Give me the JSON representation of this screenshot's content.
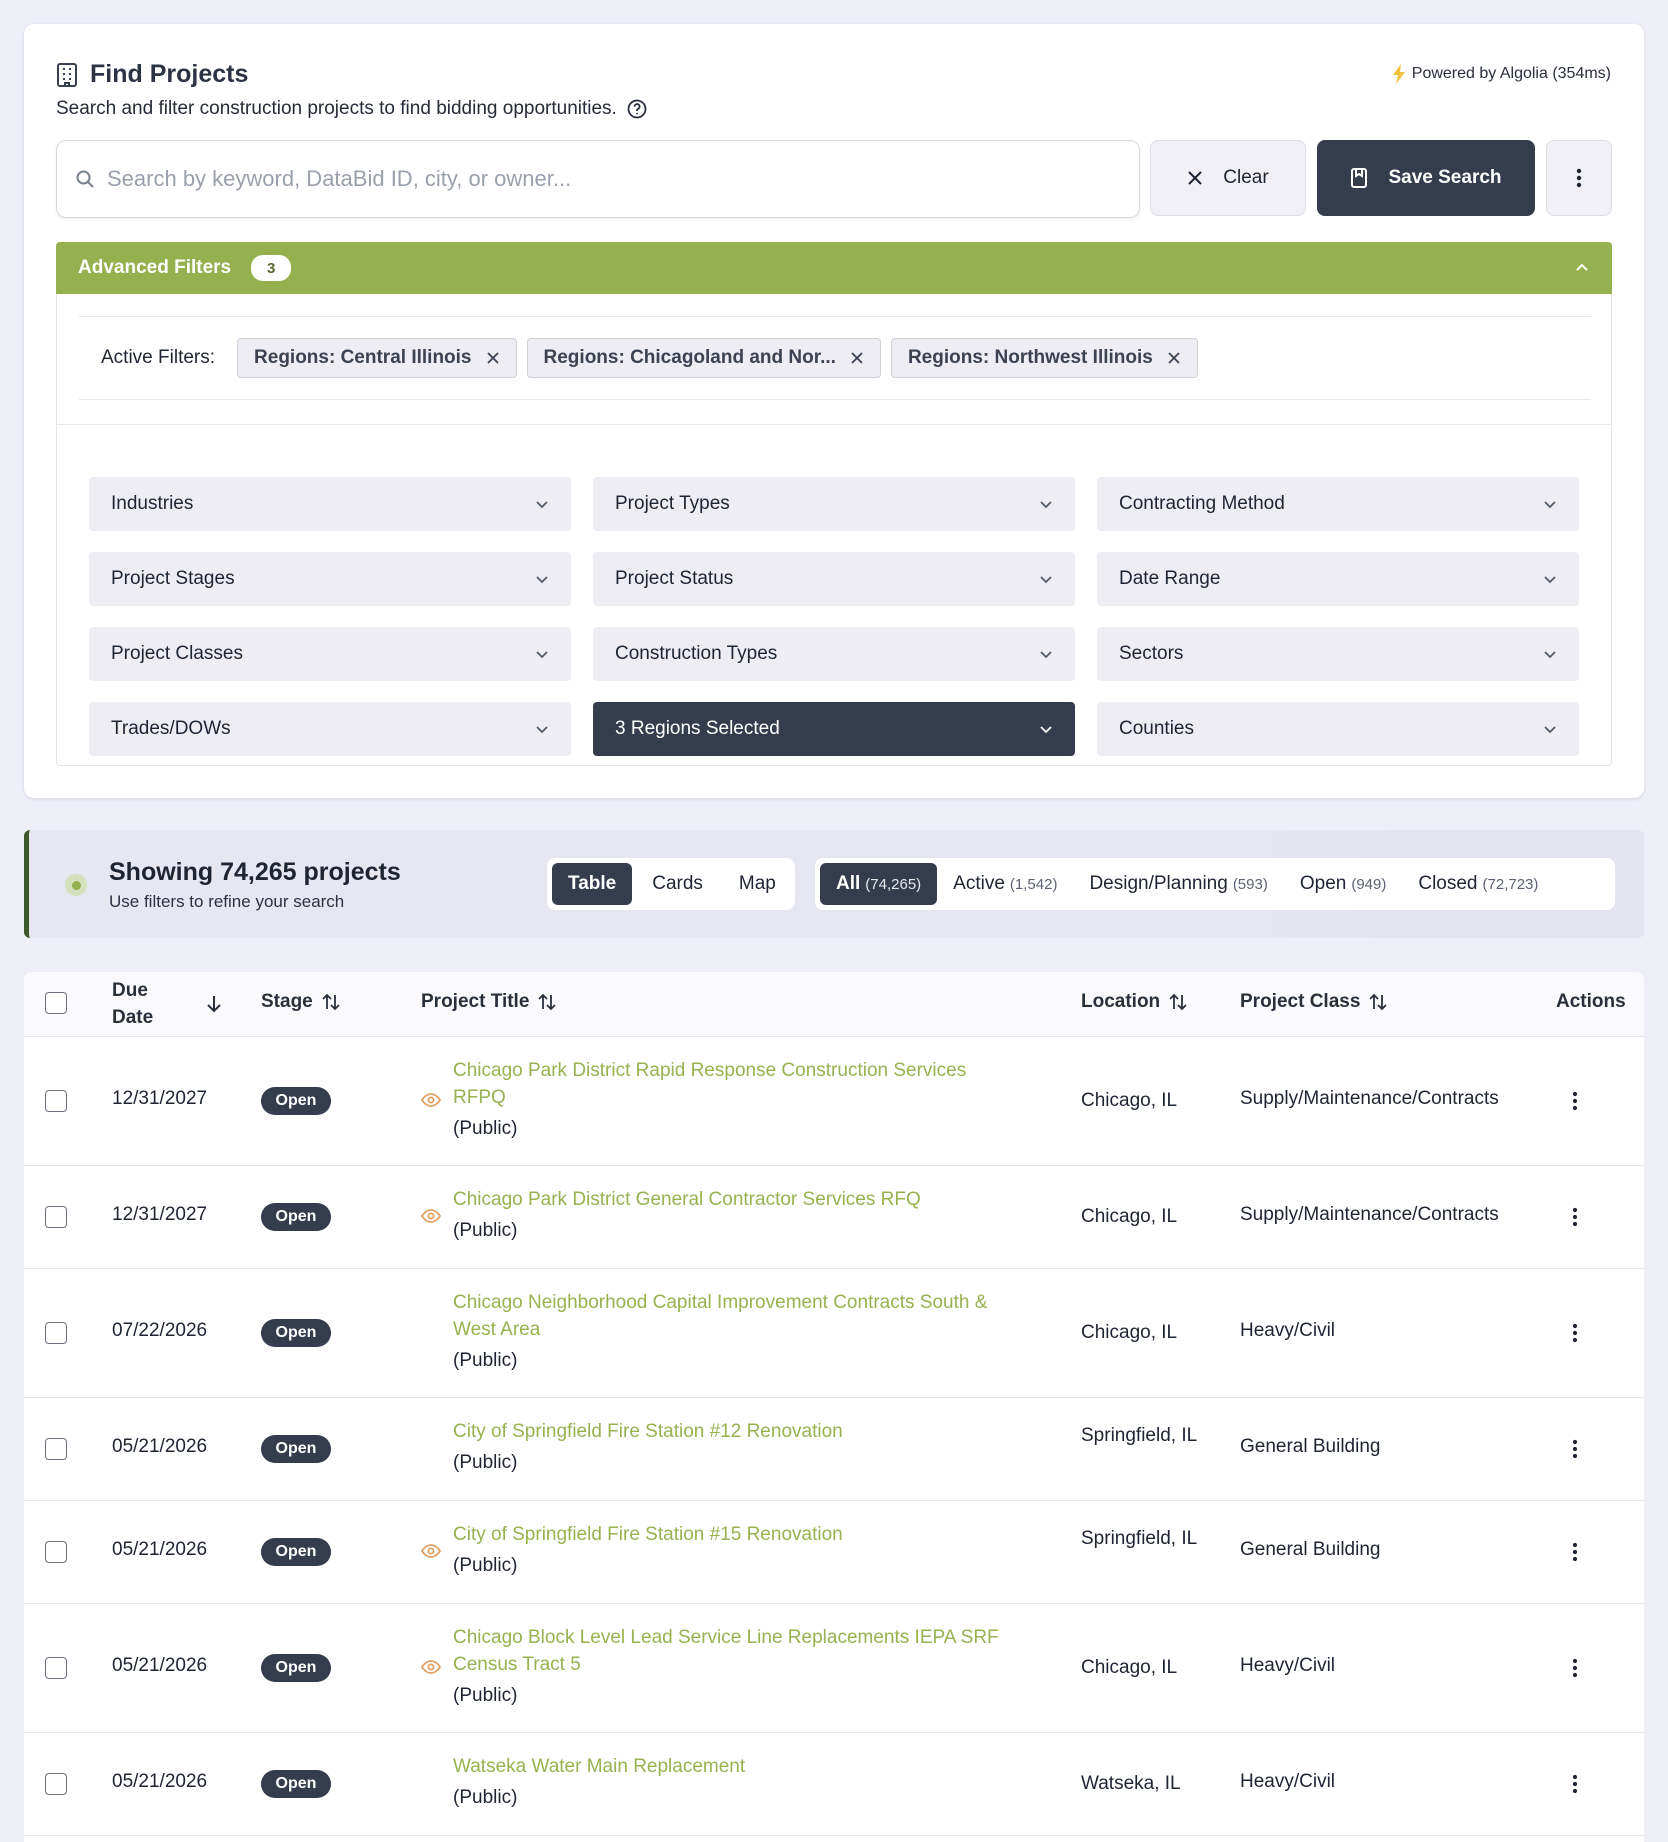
{
  "header": {
    "title": "Find Projects",
    "powered_by": "Powered by Algolia (354ms)",
    "subtitle": "Search and filter construction projects to find bidding opportunities."
  },
  "search": {
    "placeholder": "Search by keyword, DataBid ID, city, or owner...",
    "value": "",
    "clear_label": "Clear",
    "save_label": "Save Search"
  },
  "advanced_filters": {
    "label": "Advanced Filters",
    "count": "3",
    "active_label": "Active Filters:",
    "active": [
      "Regions: Central Illinois",
      "Regions: Chicagoland and Nor...",
      "Regions: Northwest Illinois"
    ],
    "dropdowns": [
      "Industries",
      "Project Types",
      "Contracting Method",
      "Project Stages",
      "Project Status",
      "Date Range",
      "Project Classes",
      "Construction Types",
      "Sectors",
      "Trades/DOWs",
      "3 Regions Selected",
      "Counties"
    ]
  },
  "results": {
    "heading": "Showing 74,265 projects",
    "sub": "Use filters to refine your search",
    "view_tabs": [
      "Table",
      "Cards",
      "Map"
    ],
    "stage_tabs": [
      {
        "label": "All",
        "count": "(74,265)"
      },
      {
        "label": "Active",
        "count": "(1,542)"
      },
      {
        "label": "Design/Planning",
        "count": "(593)"
      },
      {
        "label": "Open",
        "count": "(949)"
      },
      {
        "label": "Closed",
        "count": "(72,723)"
      }
    ]
  },
  "table": {
    "headers": {
      "due_date": "Due Date",
      "stage": "Stage",
      "title": "Project Title",
      "location": "Location",
      "class": "Project Class",
      "actions": "Actions"
    },
    "rows": [
      {
        "date": "12/31/2027",
        "stage": "Open",
        "title": "Chicago Park District Rapid Response Construction Services RFPQ",
        "type": "(Public)",
        "location": "Chicago, IL",
        "class": "Supply/Maintenance/Contracts"
      },
      {
        "date": "12/31/2027",
        "stage": "Open",
        "title": "Chicago Park District General Contractor Services RFQ",
        "type": "(Public)",
        "location": "Chicago, IL",
        "class": "Supply/Maintenance/Contracts"
      },
      {
        "date": "07/22/2026",
        "stage": "Open",
        "title": "Chicago Neighborhood Capital Improvement Contracts South & West Area",
        "type": "(Public)",
        "location": "Chicago, IL",
        "class": "Heavy/Civil"
      },
      {
        "date": "05/21/2026",
        "stage": "Open",
        "title": "City of Springfield Fire Station #12 Renovation",
        "type": "(Public)",
        "location": "Springfield, IL",
        "class": "General Building"
      },
      {
        "date": "05/21/2026",
        "stage": "Open",
        "title": "City of Springfield Fire Station #15 Renovation",
        "type": "(Public)",
        "location": "Springfield, IL",
        "class": "General Building"
      },
      {
        "date": "05/21/2026",
        "stage": "Open",
        "title": "Chicago Block Level Lead Service Line Replacements IEPA SRF Census Tract 5",
        "type": "(Public)",
        "location": "Chicago, IL",
        "class": "Heavy/Civil"
      },
      {
        "date": "05/21/2026",
        "stage": "Open",
        "title": "Watseka Water Main Replacement",
        "type": "(Public)",
        "location": "Watseka, IL",
        "class": "Heavy/Civil"
      }
    ]
  },
  "colors": {
    "accent_green": "#95b04f",
    "dark": "#353c4d",
    "watch_icon": "#e2a165"
  }
}
